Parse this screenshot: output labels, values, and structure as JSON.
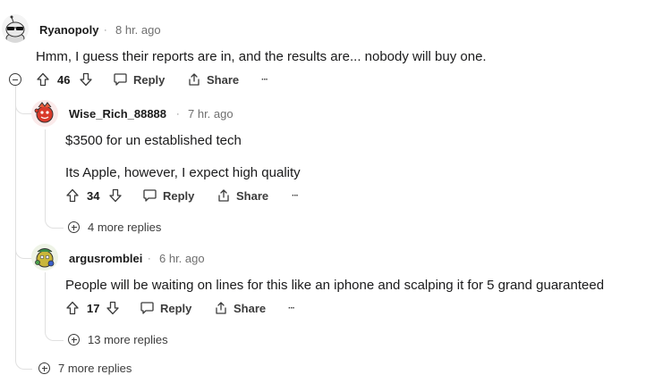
{
  "comments": [
    {
      "username": "Ryanopoly",
      "time": "8 hr. ago",
      "separator": "·",
      "lines": [
        "Hmm, I guess their reports are in, and the results are... nobody will buy one."
      ],
      "votes": "46",
      "reply_label": "Reply",
      "share_label": "Share",
      "more_label": "···"
    },
    {
      "username": "Wise_Rich_88888",
      "time": "7 hr. ago",
      "separator": "·",
      "lines": [
        "$3500 for un established tech",
        "Its Apple, however, I expect high quality"
      ],
      "votes": "34",
      "reply_label": "Reply",
      "share_label": "Share",
      "more_label": "···",
      "more_replies": "4 more replies"
    },
    {
      "username": "argusromblei",
      "time": "6 hr. ago",
      "separator": "·",
      "lines": [
        "People will be waiting on lines for this like an iphone and scalping it for 5 grand guaranteed"
      ],
      "votes": "17",
      "reply_label": "Reply",
      "share_label": "Share",
      "more_label": "···",
      "more_replies": "13 more replies"
    }
  ],
  "root_more_replies": "7 more replies"
}
